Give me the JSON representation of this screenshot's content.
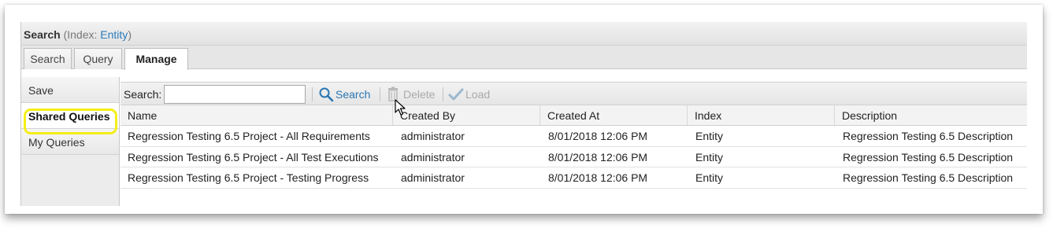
{
  "title": {
    "main": "Search",
    "paren_open": "(Index: ",
    "index": "Entity",
    "paren_close": ")"
  },
  "tabs": [
    {
      "label": "Search",
      "active": false
    },
    {
      "label": "Query",
      "active": false
    },
    {
      "label": "Manage",
      "active": true
    }
  ],
  "sidebar": {
    "items": [
      {
        "label": "Save",
        "active": false
      },
      {
        "label": "Shared Queries",
        "active": true
      },
      {
        "label": "My Queries",
        "active": false
      }
    ],
    "highlight_color": "#f5ee17"
  },
  "toolbar": {
    "search_label": "Search:",
    "search_value": "",
    "search_button": "Search",
    "delete_button": "Delete",
    "load_button": "Load",
    "accent_color": "#2a76b3",
    "disabled_color": "#aaaaaa"
  },
  "grid": {
    "columns": [
      "Name",
      "Created By",
      "Created At",
      "Index",
      "Description"
    ],
    "rows": [
      [
        "Regression Testing 6.5 Project - All Requirements",
        "administrator",
        "8/01/2018 12:06 PM",
        "Entity",
        "Regression Testing 6.5 Description"
      ],
      [
        "Regression Testing 6.5 Project - All Test Executions",
        "administrator",
        "8/01/2018 12:06 PM",
        "Entity",
        "Regression Testing 6.5 Description"
      ],
      [
        "Regression Testing 6.5 Project - Testing Progress",
        "administrator",
        "8/01/2018 12:06 PM",
        "Entity",
        "Regression Testing 6.5 Description"
      ]
    ]
  }
}
